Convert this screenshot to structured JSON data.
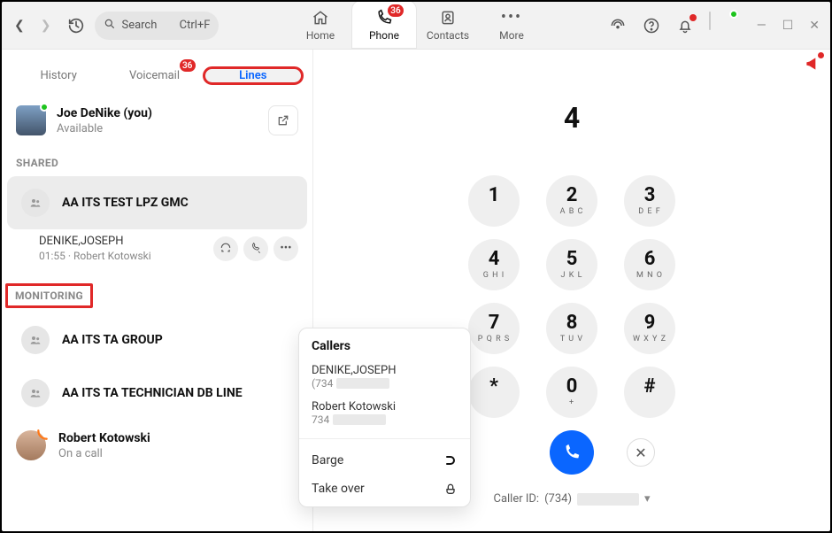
{
  "header": {
    "search_placeholder": "Search",
    "search_shortcut": "Ctrl+F",
    "tabs": [
      {
        "label": "Home"
      },
      {
        "label": "Phone",
        "badge": "36",
        "active": true
      },
      {
        "label": "Contacts"
      },
      {
        "label": "More"
      }
    ]
  },
  "subtabs": {
    "history": "History",
    "voicemail": "Voicemail",
    "voicemail_badge": "36",
    "lines": "Lines"
  },
  "me": {
    "name": "Joe DeNike (you)",
    "status": "Available"
  },
  "sections": {
    "shared": "SHARED",
    "monitoring": "MONITORING"
  },
  "shared_lines": [
    {
      "name": "AA ITS TEST LPZ GMC",
      "selected": true
    }
  ],
  "active_call": {
    "caller": "DENIKE,JOSEPH",
    "duration": "01:55",
    "other": "Robert Kotowski"
  },
  "monitoring_lines": [
    {
      "name": "AA ITS TA GROUP"
    },
    {
      "name": "AA ITS TA TECHNICIAN DB LINE"
    }
  ],
  "contact": {
    "name": "Robert Kotowski",
    "status": "On a call"
  },
  "dialer": {
    "entered": "4",
    "keys": [
      {
        "d": "1",
        "l": ""
      },
      {
        "d": "2",
        "l": "A B C"
      },
      {
        "d": "3",
        "l": "D E F"
      },
      {
        "d": "4",
        "l": "G H I"
      },
      {
        "d": "5",
        "l": "J K L"
      },
      {
        "d": "6",
        "l": "M N O"
      },
      {
        "d": "7",
        "l": "P Q R S"
      },
      {
        "d": "8",
        "l": "T U V"
      },
      {
        "d": "9",
        "l": "W X Y Z"
      },
      {
        "d": "*",
        "l": ""
      },
      {
        "d": "0",
        "l": "+"
      },
      {
        "d": "#",
        "l": ""
      }
    ],
    "caller_id_label": "Caller ID:",
    "caller_id_visible": "(734)"
  },
  "popover": {
    "title": "Callers",
    "entries": [
      {
        "name": "DENIKE,JOSEPH",
        "num_visible": "(734"
      },
      {
        "name": "Robert Kotowski",
        "num_visible": "734"
      }
    ],
    "actions": {
      "barge": "Barge",
      "takeover": "Take over"
    }
  }
}
